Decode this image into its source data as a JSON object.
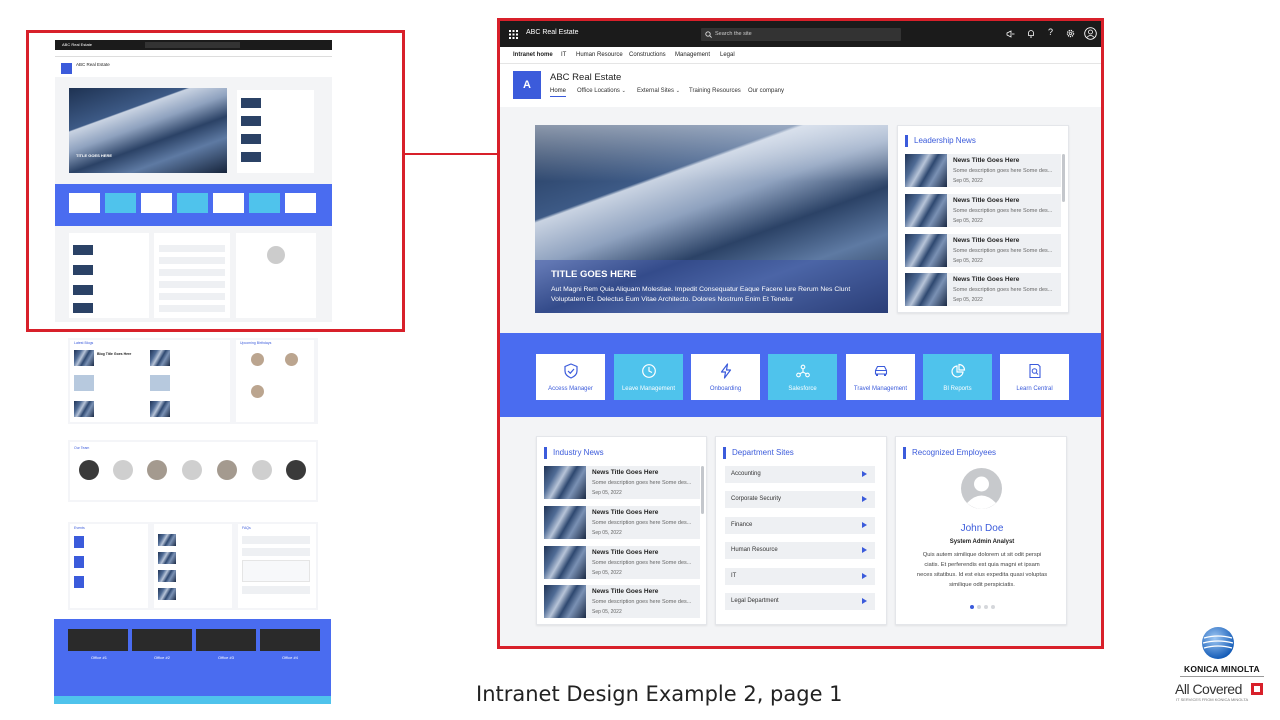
{
  "caption": "Intranet Design Example 2, page 1",
  "brand": {
    "name": "KONICA MINOLTA",
    "tagline": "All Covered",
    "subline": "IT SERVICES FROM KONICA MINOLTA",
    "colors": {
      "konica_blue": "#0a54b3",
      "red": "#d8202a"
    }
  },
  "colors": {
    "accent": "#3b5bdb",
    "cyan": "#4fc3ec",
    "band": "#4a6cf0",
    "frame": "#d8202a",
    "topbar": "#1b1b1b"
  },
  "app": {
    "title": "ABC Real Estate",
    "search_placeholder": "Search the site",
    "top_icons": [
      "waffle-icon",
      "megaphone-icon",
      "bell-icon",
      "help-icon",
      "gear-icon",
      "account-icon"
    ],
    "hub_nav": [
      "Intranet home",
      "IT",
      "Human Resource",
      "Constructions",
      "Management",
      "Legal"
    ],
    "site": {
      "logo_letter": "A",
      "title": "ABC Real Estate",
      "nav": [
        "Home",
        "Office Locations",
        "External Sites",
        "Training Resources",
        "Our company"
      ]
    }
  },
  "hero": {
    "title": "TITLE GOES HERE",
    "text_line1": "Aut Magni Rem Quia Aliquam Molestiae. Impedit Consequatur Eaque Facere Iure Rerum Nes Clunt",
    "text_line2": "Voluptatem Et. Delectus Eum Vitae Architecto. Dolores Nostrum Enim Et Tenetur"
  },
  "leadership_news": {
    "title": "Leadership News",
    "items": [
      {
        "title": "News Title Goes Here",
        "desc": "Some description goes here Some des...",
        "date": "Sep 05, 2022"
      },
      {
        "title": "News Title Goes Here",
        "desc": "Some description goes here Some des...",
        "date": "Sep 05, 2022"
      },
      {
        "title": "News Title Goes Here",
        "desc": "Some description goes here Some des...",
        "date": "Sep 05, 2022"
      },
      {
        "title": "News Title Goes Here",
        "desc": "Some description goes here Some des...",
        "date": "Sep 05, 2022"
      }
    ]
  },
  "quick_links": [
    {
      "label": "Access Manager",
      "icon": "shield-check-icon",
      "style": "white"
    },
    {
      "label": "Leave Management",
      "icon": "clock-icon",
      "style": "cyan"
    },
    {
      "label": "Onboarding",
      "icon": "lightning-icon",
      "style": "white"
    },
    {
      "label": "Salesforce",
      "icon": "network-icon",
      "style": "cyan"
    },
    {
      "label": "Travel Management",
      "icon": "car-icon",
      "style": "white"
    },
    {
      "label": "BI Reports",
      "icon": "pie-chart-icon",
      "style": "cyan"
    },
    {
      "label": "Learn Central",
      "icon": "document-search-icon",
      "style": "white"
    }
  ],
  "industry_news": {
    "title": "Industry News",
    "items": [
      {
        "title": "News Title Goes Here",
        "desc": "Some description goes here Some des...",
        "date": "Sep 05, 2022"
      },
      {
        "title": "News Title Goes Here",
        "desc": "Some description goes here Some des...",
        "date": "Sep 05, 2022"
      },
      {
        "title": "News Title Goes Here",
        "desc": "Some description goes here Some des...",
        "date": "Sep 05, 2022"
      },
      {
        "title": "News Title Goes Here",
        "desc": "Some description goes here Some des...",
        "date": "Sep 05, 2022"
      }
    ]
  },
  "department_sites": {
    "title": "Department Sites",
    "items": [
      "Accounting",
      "Corporate Security",
      "Finance",
      "Human Resource",
      "IT",
      "Legal Department"
    ]
  },
  "recognized": {
    "title": "Recognized Employees",
    "name": "John Doe",
    "role": "System Admin Analyst",
    "text_line1": "Quis autem similique dolorem ut sit odit perspi",
    "text_line2": "ciatis. Et perferendis est quia magni et ipsam",
    "text_line3": "neces sitatibus. Id est eius expedita quasi voluptas",
    "text_line4": "similique odit perspiciatis."
  },
  "thumbs": {
    "blogs_title": "Latest Blogs",
    "blog_item": "Blog Title Goes Here",
    "birthdays_title": "Upcoming Birthdays",
    "team_title": "Our Team",
    "events_title": "Events",
    "faq_title": "FAQs",
    "offices": [
      "Office #1",
      "Office #2",
      "Office #3",
      "Office #4"
    ]
  }
}
